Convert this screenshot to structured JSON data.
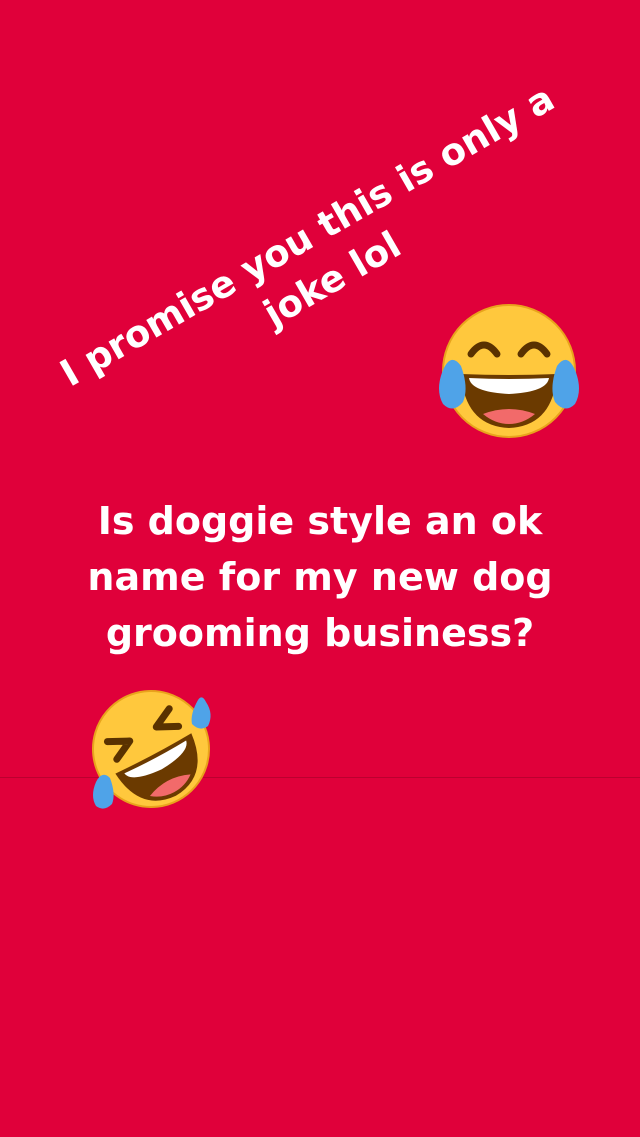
{
  "story": {
    "colors": {
      "background": "#E0003A",
      "text": "#FFFFFF",
      "emoji_face": "#FFC83D",
      "emoji_tear": "#4FA3E8"
    },
    "diagonal_caption": {
      "lines": [
        "I promise you this is only a",
        "joke lol"
      ]
    },
    "question": {
      "lines": [
        "Is doggie style an ok",
        "name for my new dog",
        "grooming business?"
      ]
    },
    "stickers": [
      {
        "name": "face-with-tears-of-joy"
      },
      {
        "name": "rolling-on-the-floor-laughing"
      }
    ]
  }
}
